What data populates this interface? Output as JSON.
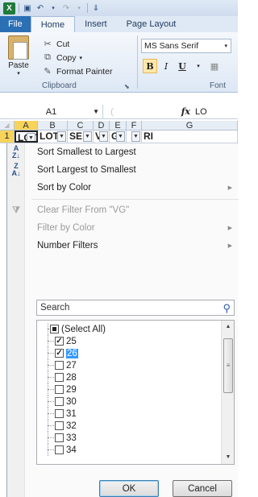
{
  "qat": {
    "icons": [
      "excel-logo",
      "save-icon",
      "undo-icon",
      "redo-icon",
      "customize-icon"
    ]
  },
  "tabs": [
    "File",
    "Home",
    "Insert",
    "Page Layout"
  ],
  "ribbon": {
    "paste_label": "Paste",
    "cut_label": "Cut",
    "copy_label": "Copy",
    "format_painter_label": "Format Painter",
    "clipboard_group": "Clipboard",
    "font_name": "MS Sans Serif",
    "font_group": "Font",
    "bold": "B",
    "italic": "I",
    "underline": "U"
  },
  "formula_bar": {
    "name_box": "A1",
    "fx": "fx",
    "value": "LO"
  },
  "columns": [
    "A",
    "B",
    "C",
    "D",
    "E",
    "F",
    "G"
  ],
  "row1": {
    "number": "1",
    "cells": [
      "LOT",
      "LOT",
      "SE",
      "V",
      "G",
      "",
      "RI"
    ]
  },
  "menu": {
    "sort_asc": "Sort Smallest to Largest",
    "sort_desc": "Sort Largest to Smallest",
    "sort_color": "Sort by Color",
    "clear_filter": "Clear Filter From \"VG\"",
    "filter_color": "Filter by Color",
    "number_filters": "Number Filters",
    "search_placeholder": "Search",
    "select_all": "(Select All)",
    "items": [
      {
        "label": "25",
        "checked": true
      },
      {
        "label": "26",
        "checked": true
      },
      {
        "label": "27",
        "checked": false
      },
      {
        "label": "28",
        "checked": false
      },
      {
        "label": "29",
        "checked": false
      },
      {
        "label": "30",
        "checked": false
      },
      {
        "label": "31",
        "checked": false
      },
      {
        "label": "32",
        "checked": false
      },
      {
        "label": "33",
        "checked": false
      },
      {
        "label": "34",
        "checked": false
      }
    ],
    "ok": "OK",
    "cancel": "Cancel"
  }
}
